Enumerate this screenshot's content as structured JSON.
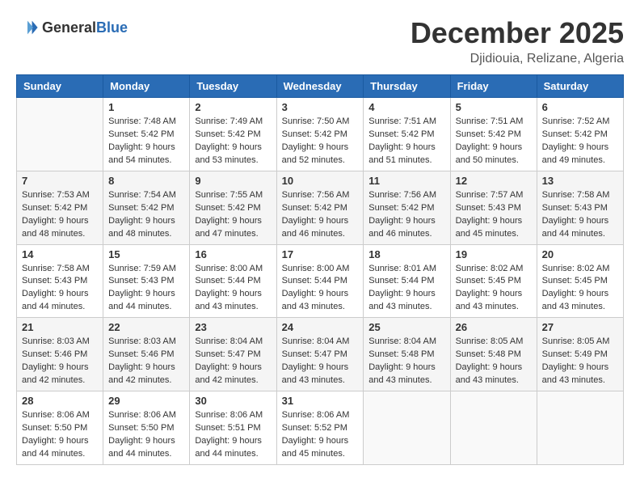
{
  "header": {
    "logo_general": "General",
    "logo_blue": "Blue",
    "month_title": "December 2025",
    "location": "Djidiouia, Relizane, Algeria"
  },
  "days_of_week": [
    "Sunday",
    "Monday",
    "Tuesday",
    "Wednesday",
    "Thursday",
    "Friday",
    "Saturday"
  ],
  "weeks": [
    [
      {
        "day": "",
        "sunrise": "",
        "sunset": "",
        "daylight": ""
      },
      {
        "day": "1",
        "sunrise": "Sunrise: 7:48 AM",
        "sunset": "Sunset: 5:42 PM",
        "daylight": "Daylight: 9 hours and 54 minutes."
      },
      {
        "day": "2",
        "sunrise": "Sunrise: 7:49 AM",
        "sunset": "Sunset: 5:42 PM",
        "daylight": "Daylight: 9 hours and 53 minutes."
      },
      {
        "day": "3",
        "sunrise": "Sunrise: 7:50 AM",
        "sunset": "Sunset: 5:42 PM",
        "daylight": "Daylight: 9 hours and 52 minutes."
      },
      {
        "day": "4",
        "sunrise": "Sunrise: 7:51 AM",
        "sunset": "Sunset: 5:42 PM",
        "daylight": "Daylight: 9 hours and 51 minutes."
      },
      {
        "day": "5",
        "sunrise": "Sunrise: 7:51 AM",
        "sunset": "Sunset: 5:42 PM",
        "daylight": "Daylight: 9 hours and 50 minutes."
      },
      {
        "day": "6",
        "sunrise": "Sunrise: 7:52 AM",
        "sunset": "Sunset: 5:42 PM",
        "daylight": "Daylight: 9 hours and 49 minutes."
      }
    ],
    [
      {
        "day": "7",
        "sunrise": "Sunrise: 7:53 AM",
        "sunset": "Sunset: 5:42 PM",
        "daylight": "Daylight: 9 hours and 48 minutes."
      },
      {
        "day": "8",
        "sunrise": "Sunrise: 7:54 AM",
        "sunset": "Sunset: 5:42 PM",
        "daylight": "Daylight: 9 hours and 48 minutes."
      },
      {
        "day": "9",
        "sunrise": "Sunrise: 7:55 AM",
        "sunset": "Sunset: 5:42 PM",
        "daylight": "Daylight: 9 hours and 47 minutes."
      },
      {
        "day": "10",
        "sunrise": "Sunrise: 7:56 AM",
        "sunset": "Sunset: 5:42 PM",
        "daylight": "Daylight: 9 hours and 46 minutes."
      },
      {
        "day": "11",
        "sunrise": "Sunrise: 7:56 AM",
        "sunset": "Sunset: 5:42 PM",
        "daylight": "Daylight: 9 hours and 46 minutes."
      },
      {
        "day": "12",
        "sunrise": "Sunrise: 7:57 AM",
        "sunset": "Sunset: 5:43 PM",
        "daylight": "Daylight: 9 hours and 45 minutes."
      },
      {
        "day": "13",
        "sunrise": "Sunrise: 7:58 AM",
        "sunset": "Sunset: 5:43 PM",
        "daylight": "Daylight: 9 hours and 44 minutes."
      }
    ],
    [
      {
        "day": "14",
        "sunrise": "Sunrise: 7:58 AM",
        "sunset": "Sunset: 5:43 PM",
        "daylight": "Daylight: 9 hours and 44 minutes."
      },
      {
        "day": "15",
        "sunrise": "Sunrise: 7:59 AM",
        "sunset": "Sunset: 5:43 PM",
        "daylight": "Daylight: 9 hours and 44 minutes."
      },
      {
        "day": "16",
        "sunrise": "Sunrise: 8:00 AM",
        "sunset": "Sunset: 5:44 PM",
        "daylight": "Daylight: 9 hours and 43 minutes."
      },
      {
        "day": "17",
        "sunrise": "Sunrise: 8:00 AM",
        "sunset": "Sunset: 5:44 PM",
        "daylight": "Daylight: 9 hours and 43 minutes."
      },
      {
        "day": "18",
        "sunrise": "Sunrise: 8:01 AM",
        "sunset": "Sunset: 5:44 PM",
        "daylight": "Daylight: 9 hours and 43 minutes."
      },
      {
        "day": "19",
        "sunrise": "Sunrise: 8:02 AM",
        "sunset": "Sunset: 5:45 PM",
        "daylight": "Daylight: 9 hours and 43 minutes."
      },
      {
        "day": "20",
        "sunrise": "Sunrise: 8:02 AM",
        "sunset": "Sunset: 5:45 PM",
        "daylight": "Daylight: 9 hours and 43 minutes."
      }
    ],
    [
      {
        "day": "21",
        "sunrise": "Sunrise: 8:03 AM",
        "sunset": "Sunset: 5:46 PM",
        "daylight": "Daylight: 9 hours and 42 minutes."
      },
      {
        "day": "22",
        "sunrise": "Sunrise: 8:03 AM",
        "sunset": "Sunset: 5:46 PM",
        "daylight": "Daylight: 9 hours and 42 minutes."
      },
      {
        "day": "23",
        "sunrise": "Sunrise: 8:04 AM",
        "sunset": "Sunset: 5:47 PM",
        "daylight": "Daylight: 9 hours and 42 minutes."
      },
      {
        "day": "24",
        "sunrise": "Sunrise: 8:04 AM",
        "sunset": "Sunset: 5:47 PM",
        "daylight": "Daylight: 9 hours and 43 minutes."
      },
      {
        "day": "25",
        "sunrise": "Sunrise: 8:04 AM",
        "sunset": "Sunset: 5:48 PM",
        "daylight": "Daylight: 9 hours and 43 minutes."
      },
      {
        "day": "26",
        "sunrise": "Sunrise: 8:05 AM",
        "sunset": "Sunset: 5:48 PM",
        "daylight": "Daylight: 9 hours and 43 minutes."
      },
      {
        "day": "27",
        "sunrise": "Sunrise: 8:05 AM",
        "sunset": "Sunset: 5:49 PM",
        "daylight": "Daylight: 9 hours and 43 minutes."
      }
    ],
    [
      {
        "day": "28",
        "sunrise": "Sunrise: 8:06 AM",
        "sunset": "Sunset: 5:50 PM",
        "daylight": "Daylight: 9 hours and 44 minutes."
      },
      {
        "day": "29",
        "sunrise": "Sunrise: 8:06 AM",
        "sunset": "Sunset: 5:50 PM",
        "daylight": "Daylight: 9 hours and 44 minutes."
      },
      {
        "day": "30",
        "sunrise": "Sunrise: 8:06 AM",
        "sunset": "Sunset: 5:51 PM",
        "daylight": "Daylight: 9 hours and 44 minutes."
      },
      {
        "day": "31",
        "sunrise": "Sunrise: 8:06 AM",
        "sunset": "Sunset: 5:52 PM",
        "daylight": "Daylight: 9 hours and 45 minutes."
      },
      {
        "day": "",
        "sunrise": "",
        "sunset": "",
        "daylight": ""
      },
      {
        "day": "",
        "sunrise": "",
        "sunset": "",
        "daylight": ""
      },
      {
        "day": "",
        "sunrise": "",
        "sunset": "",
        "daylight": ""
      }
    ]
  ]
}
